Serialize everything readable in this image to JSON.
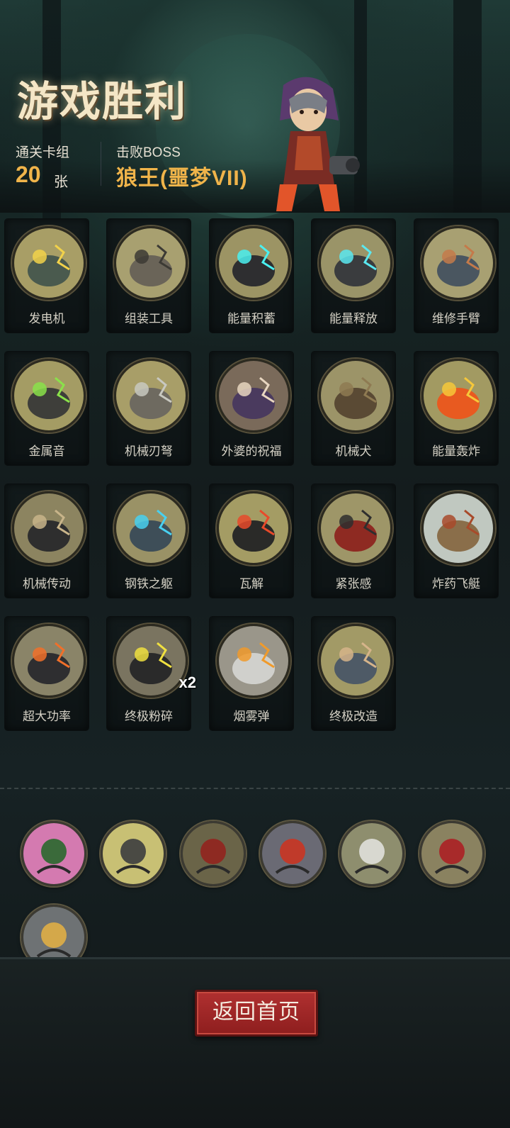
{
  "header": {
    "title": "游戏胜利",
    "deck_label": "通关卡组",
    "deck_count": "20",
    "deck_unit": "张",
    "boss_label": "击败BOSS",
    "boss_name": "狼王(噩梦VII)"
  },
  "cards": [
    {
      "label": "发电机",
      "icon": "generator-icon"
    },
    {
      "label": "组装工具",
      "icon": "tools-icon"
    },
    {
      "label": "能量积蓄",
      "icon": "energy-charge-icon"
    },
    {
      "label": "能量释放",
      "icon": "energy-release-icon"
    },
    {
      "label": "维修手臂",
      "icon": "repair-arm-icon"
    },
    {
      "label": "金属音",
      "icon": "metal-horn-icon"
    },
    {
      "label": "机械刃弩",
      "icon": "blade-crossbow-icon"
    },
    {
      "label": "外婆的祝福",
      "icon": "grandma-blessing-icon"
    },
    {
      "label": "机械犬",
      "icon": "mech-dog-icon"
    },
    {
      "label": "能量轰炸",
      "icon": "energy-bombard-icon"
    },
    {
      "label": "机械传动",
      "icon": "mech-drive-icon"
    },
    {
      "label": "钢铁之躯",
      "icon": "steel-body-icon"
    },
    {
      "label": "瓦解",
      "icon": "disintegrate-icon"
    },
    {
      "label": "紧张感",
      "icon": "tension-dynamite-icon"
    },
    {
      "label": "炸药飞艇",
      "icon": "dynamite-airship-icon"
    },
    {
      "label": "超大功率",
      "icon": "overpower-icon"
    },
    {
      "label": "终极粉碎",
      "icon": "ultimate-crush-icon",
      "badge": "x2"
    },
    {
      "label": "烟雾弹",
      "icon": "smoke-bomb-icon"
    },
    {
      "label": "终极改造",
      "icon": "ultimate-mod-icon"
    }
  ],
  "relics": [
    {
      "icon": "pink-vine-relic-icon"
    },
    {
      "icon": "chain-burst-relic-icon"
    },
    {
      "icon": "card-pair-relic-icon"
    },
    {
      "icon": "vampire-relic-icon"
    },
    {
      "icon": "warrior-relic-icon"
    },
    {
      "icon": "dracula-relic-icon"
    },
    {
      "icon": "armored-knight-relic-icon"
    }
  ],
  "footer": {
    "home_button": "返回首页"
  },
  "colors": {
    "accent_gold": "#f0b44a",
    "button_red": "#9e2424",
    "card_art_bg": "#a8a06a"
  }
}
